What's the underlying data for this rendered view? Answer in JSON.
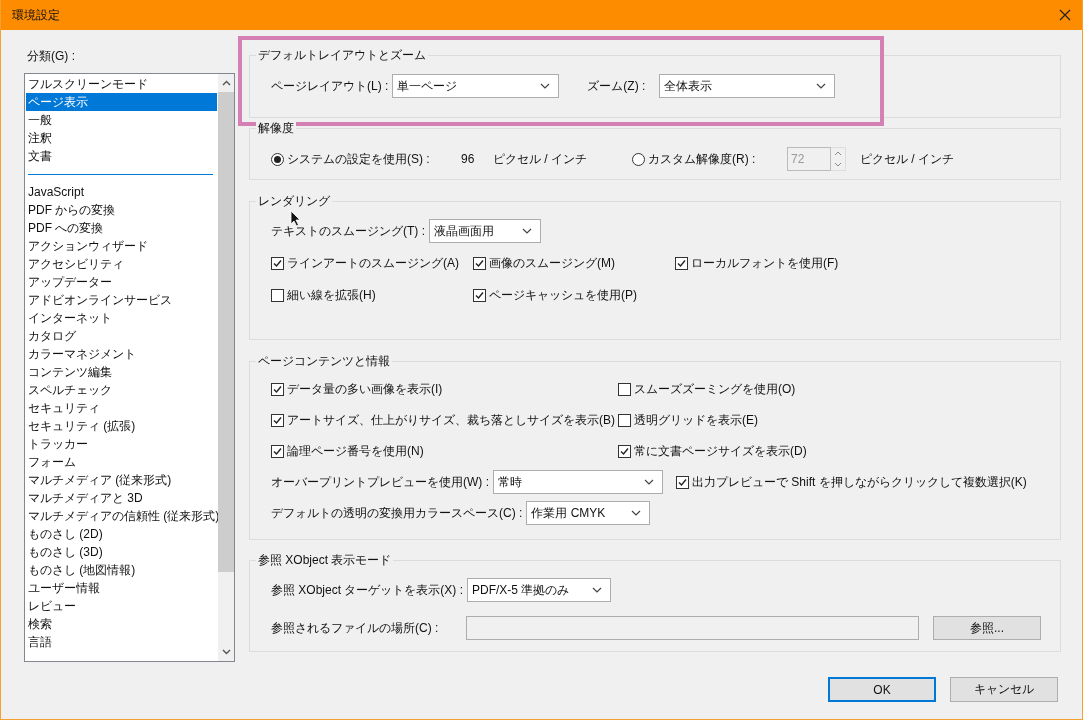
{
  "window": {
    "title": "環境設定"
  },
  "category": {
    "label": "分類(G) :",
    "sections": [
      [
        {
          "label": "フルスクリーンモード",
          "selected": false
        },
        {
          "label": "ページ表示",
          "selected": true
        },
        {
          "label": "一般",
          "selected": false
        },
        {
          "label": "注釈",
          "selected": false
        },
        {
          "label": "文書",
          "selected": false
        }
      ],
      [
        {
          "label": "JavaScript",
          "selected": false
        },
        {
          "label": "PDF からの変換",
          "selected": false
        },
        {
          "label": "PDF への変換",
          "selected": false
        },
        {
          "label": "アクションウィザード",
          "selected": false
        },
        {
          "label": "アクセシビリティ",
          "selected": false
        },
        {
          "label": "アップデーター",
          "selected": false
        },
        {
          "label": "アドビオンラインサービス",
          "selected": false
        },
        {
          "label": "インターネット",
          "selected": false
        },
        {
          "label": "カタログ",
          "selected": false
        },
        {
          "label": "カラーマネジメント",
          "selected": false
        },
        {
          "label": "コンテンツ編集",
          "selected": false
        },
        {
          "label": "スペルチェック",
          "selected": false
        },
        {
          "label": "セキュリティ",
          "selected": false
        },
        {
          "label": "セキュリティ (拡張)",
          "selected": false
        },
        {
          "label": "トラッカー",
          "selected": false
        },
        {
          "label": "フォーム",
          "selected": false
        },
        {
          "label": "マルチメディア (従来形式)",
          "selected": false
        },
        {
          "label": "マルチメディアと 3D",
          "selected": false
        },
        {
          "label": "マルチメディアの信頼性 (従来形式)",
          "selected": false
        },
        {
          "label": "ものさし (2D)",
          "selected": false
        },
        {
          "label": "ものさし (3D)",
          "selected": false
        },
        {
          "label": "ものさし (地図情報)",
          "selected": false
        },
        {
          "label": "ユーザー情報",
          "selected": false
        },
        {
          "label": "レビュー",
          "selected": false
        },
        {
          "label": "検索",
          "selected": false
        },
        {
          "label": "言語",
          "selected": false
        }
      ]
    ]
  },
  "groups": [
    {
      "title": "デフォルトレイアウトとズーム",
      "highlighted": true,
      "rows": [
        [
          {
            "kind": "label",
            "text": "ページレイアウト(L) :"
          },
          {
            "kind": "dropdown",
            "value": "単一ページ"
          },
          {
            "kind": "label",
            "text": "ズーム(Z) :"
          },
          {
            "kind": "dropdown",
            "value": "全体表示"
          }
        ]
      ]
    },
    {
      "title": "解像度",
      "highlighted": false,
      "rows": [
        [
          {
            "kind": "radio",
            "label": "システムの設定を使用(S) :",
            "selected": true
          },
          {
            "kind": "label",
            "text": "96"
          },
          {
            "kind": "label",
            "text": "ピクセル / インチ"
          },
          {
            "kind": "radio",
            "label": "カスタム解像度(R) :",
            "selected": false
          },
          {
            "kind": "spin",
            "value": "72",
            "disabled": true
          },
          {
            "kind": "label",
            "text": "ピクセル / インチ"
          }
        ]
      ]
    },
    {
      "title": "レンダリング",
      "highlighted": false,
      "rows": [
        [
          {
            "kind": "label",
            "text": "テキストのスムージング(T) :"
          },
          {
            "kind": "dropdown",
            "value": "液晶画面用"
          }
        ],
        [
          {
            "kind": "checkbox",
            "label": "ラインアートのスムージング(A)",
            "checked": true
          },
          {
            "kind": "checkbox",
            "label": "画像のスムージング(M)",
            "checked": true
          },
          {
            "kind": "checkbox",
            "label": "ローカルフォントを使用(F)",
            "checked": true
          }
        ],
        [
          {
            "kind": "checkbox",
            "label": "細い線を拡張(H)",
            "checked": false
          },
          {
            "kind": "checkbox",
            "label": "ページキャッシュを使用(P)",
            "checked": true
          }
        ]
      ]
    },
    {
      "title": "ページコンテンツと情報",
      "highlighted": false,
      "rows": [
        [
          {
            "kind": "checkbox",
            "label": "データ量の多い画像を表示(I)",
            "checked": true
          },
          {
            "kind": "checkbox",
            "label": "スムーズズーミングを使用(O)",
            "checked": false
          }
        ],
        [
          {
            "kind": "checkbox",
            "label": "アートサイズ、仕上がりサイズ、裁ち落としサイズを表示(B)",
            "checked": true
          },
          {
            "kind": "checkbox",
            "label": "透明グリッドを表示(E)",
            "checked": false
          }
        ],
        [
          {
            "kind": "checkbox",
            "label": "論理ページ番号を使用(N)",
            "checked": true
          },
          {
            "kind": "checkbox",
            "label": "常に文書ページサイズを表示(D)",
            "checked": true
          }
        ],
        [
          {
            "kind": "label",
            "text": "オーバープリントプレビューを使用(W) :"
          },
          {
            "kind": "dropdown",
            "value": "常時"
          },
          {
            "kind": "checkbox",
            "label": "出力プレビューで Shift を押しながらクリックして複数選択(K)",
            "checked": true
          }
        ],
        [
          {
            "kind": "label",
            "text": "デフォルトの透明の変換用カラースペース(C) :"
          },
          {
            "kind": "dropdown",
            "value": "作業用 CMYK"
          }
        ]
      ]
    },
    {
      "title": "参照 XObject 表示モード",
      "highlighted": false,
      "rows": [
        [
          {
            "kind": "label",
            "text": "参照 XObject ターゲットを表示(X) :"
          },
          {
            "kind": "dropdown",
            "value": "PDF/X-5 準拠のみ"
          }
        ],
        [
          {
            "kind": "label",
            "text": "参照されるファイルの場所(C) :"
          },
          {
            "kind": "field"
          },
          {
            "kind": "button",
            "label": "参照..."
          }
        ]
      ]
    }
  ],
  "buttons": [
    {
      "label": "OK",
      "default": true
    },
    {
      "label": "キャンセル",
      "default": false
    }
  ]
}
